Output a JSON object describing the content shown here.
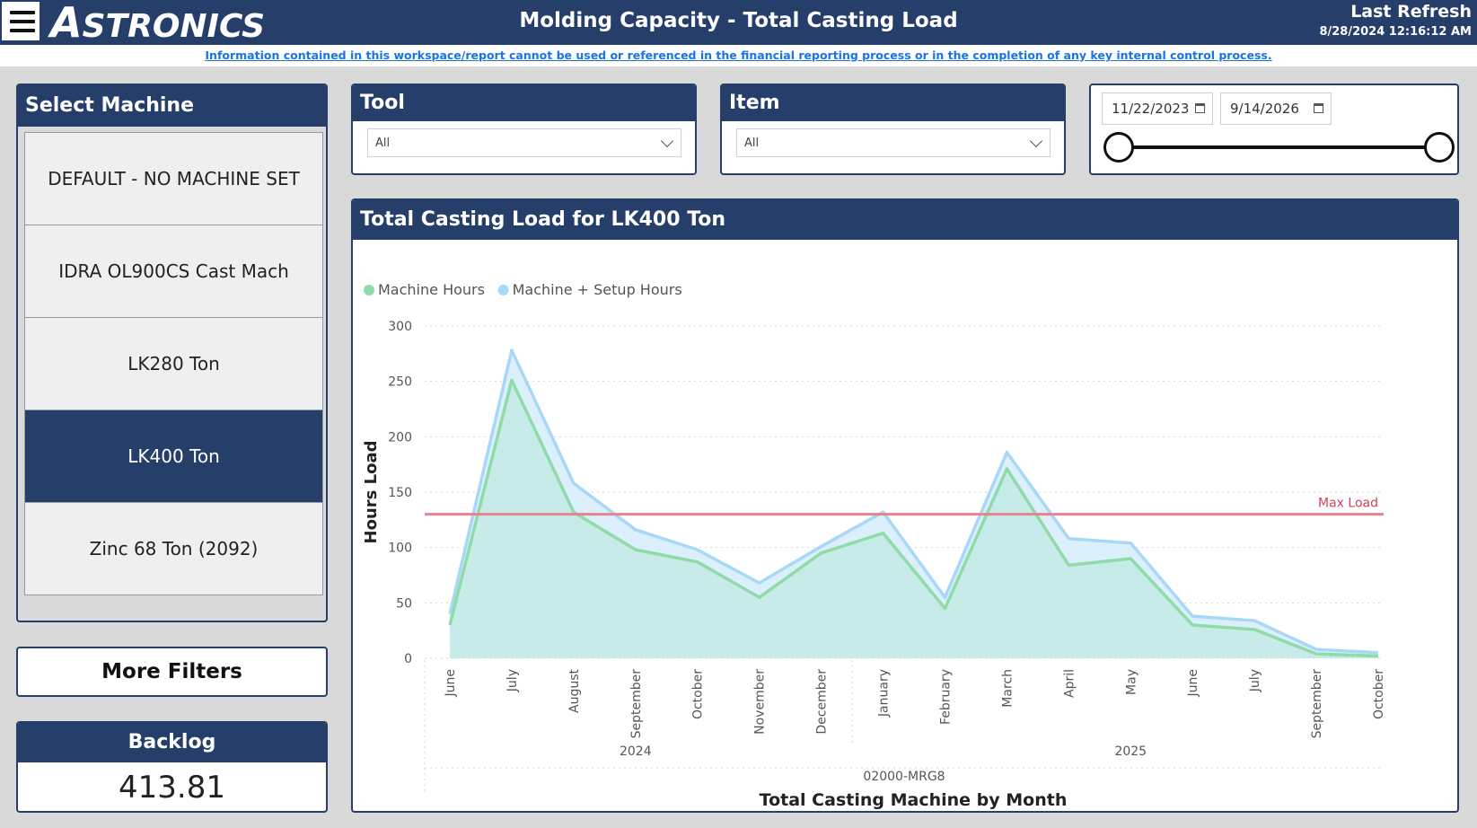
{
  "header": {
    "brand": "ASTRONICS",
    "title": "Molding Capacity - Total Casting Load",
    "refresh_label": "Last Refresh",
    "refresh_time": "8/28/2024 12:16:12 AM",
    "menu_icon": "hamburger-menu-icon"
  },
  "disclaimer": "Information contained in this workspace/report cannot be used or referenced in the financial reporting process or in the completion of any key internal control process.",
  "machine_selector": {
    "title": "Select Machine",
    "items": [
      {
        "label": "DEFAULT - NO MACHINE SET",
        "selected": false
      },
      {
        "label": "IDRA OL900CS Cast Mach",
        "selected": false
      },
      {
        "label": "LK280 Ton",
        "selected": false
      },
      {
        "label": "LK400 Ton",
        "selected": true
      },
      {
        "label": "Zinc 68 Ton (2092)",
        "selected": false
      }
    ]
  },
  "tool_filter": {
    "title": "Tool",
    "value": "All"
  },
  "item_filter": {
    "title": "Item",
    "value": "All"
  },
  "date_range": {
    "start": "11/22/2023",
    "end": "9/14/2026",
    "start_fraction": 0,
    "end_fraction": 1
  },
  "more_filters_label": "More Filters",
  "backlog": {
    "title": "Backlog",
    "value": "413.81"
  },
  "colors": {
    "navy": "#263e6a",
    "machine_hours": "#8fdca8",
    "setup_hours": "#a9d8f7",
    "max_load": "#e7838f"
  },
  "chart_data": {
    "type": "area",
    "title": "Total Casting Load for LK400 Ton",
    "xlabel": "Total Casting Machine by Month",
    "ylabel": "Hours Load",
    "ylim": [
      0,
      300
    ],
    "yticks": [
      0,
      50,
      100,
      150,
      200,
      250,
      300
    ],
    "legend_position": "top-left",
    "grid": true,
    "categories": [
      "June",
      "July",
      "August",
      "September",
      "October",
      "November",
      "December",
      "January",
      "February",
      "March",
      "April",
      "May",
      "June",
      "July",
      "September",
      "October"
    ],
    "year_groups": [
      {
        "label": "2024",
        "months": 7
      },
      {
        "label": "2025",
        "months": 9
      }
    ],
    "group_label": "02000-MRG8",
    "series": [
      {
        "name": "Machine Hours",
        "color": "#8fdca8",
        "values": [
          30,
          251,
          132,
          98,
          87,
          55,
          95,
          113,
          45,
          171,
          84,
          90,
          30,
          26,
          4,
          2
        ]
      },
      {
        "name": "Machine + Setup Hours",
        "color": "#a9d8f7",
        "values": [
          40,
          278,
          158,
          116,
          98,
          68,
          101,
          132,
          55,
          186,
          108,
          104,
          38,
          34,
          8,
          5
        ]
      }
    ],
    "reference_line": {
      "label": "Max Load",
      "value": 130
    }
  }
}
